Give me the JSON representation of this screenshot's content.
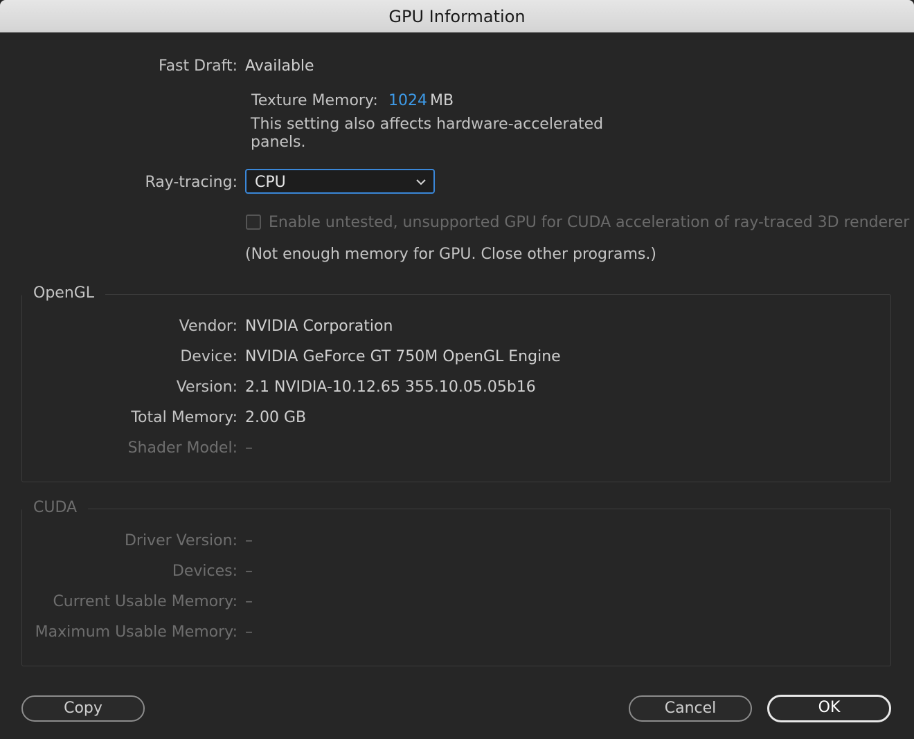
{
  "window": {
    "title": "GPU Information"
  },
  "fast_draft": {
    "label": "Fast Draft:",
    "value": "Available"
  },
  "texture_memory": {
    "label": "Texture Memory:",
    "value": "1024",
    "unit": "MB",
    "note_line1": "This setting also affects hardware-accelerated",
    "note_line2": "panels."
  },
  "ray_tracing": {
    "label": "Ray-tracing:",
    "selected": "CPU",
    "checkbox_label": "Enable untested, unsupported GPU for CUDA acceleration of ray-traced 3D renderer",
    "checkbox_checked": false,
    "memory_note": "(Not enough memory for GPU. Close other programs.)"
  },
  "opengl": {
    "title": "OpenGL",
    "rows": [
      {
        "label": "Vendor:",
        "value": "NVIDIA Corporation"
      },
      {
        "label": "Device:",
        "value": "NVIDIA GeForce GT 750M OpenGL Engine"
      },
      {
        "label": "Version:",
        "value": "2.1 NVIDIA-10.12.65 355.10.05.05b16"
      },
      {
        "label": "Total Memory:",
        "value": "2.00 GB"
      },
      {
        "label": "Shader Model:",
        "value": "–"
      }
    ]
  },
  "cuda": {
    "title": "CUDA",
    "rows": [
      {
        "label": "Driver Version:",
        "value": "–"
      },
      {
        "label": "Devices:",
        "value": "–"
      },
      {
        "label": "Current Usable Memory:",
        "value": "–"
      },
      {
        "label": "Maximum Usable Memory:",
        "value": "–"
      }
    ]
  },
  "buttons": {
    "copy": "Copy",
    "cancel": "Cancel",
    "ok": "OK"
  },
  "colors": {
    "accent": "#3d9be9",
    "focus_ring": "#3a87d8"
  }
}
